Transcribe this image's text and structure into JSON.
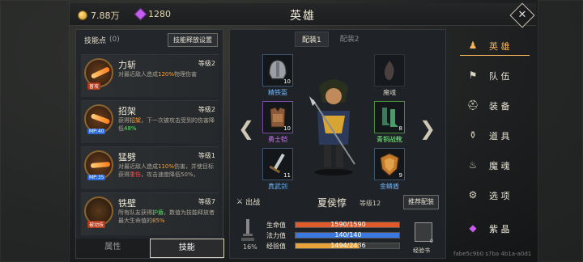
{
  "topbar": {
    "gold": "7.88万",
    "gems": "1280",
    "title": "英雄",
    "close": "✕"
  },
  "skills_panel": {
    "header": "技能点",
    "points": "(0)",
    "release_btn": "技能释放设置",
    "skills": [
      {
        "name": "力斩",
        "level": "等级2",
        "tag": "普攻",
        "tag_color": "#b13a1c",
        "desc_a": "对最近敌人造成",
        "desc_hl": "120%",
        "desc_b": "物理伤害"
      },
      {
        "name": "招架",
        "level": "等级2",
        "tag": "MP:40",
        "tag_color": "#2c6bd8",
        "desc_a": "获得",
        "desc_hl": "招架",
        "desc_b": "，下一次被攻击受到的伤害降低",
        "desc_hl2": "48%"
      },
      {
        "name": "猛劈",
        "level": "等级1",
        "tag": "MP:35",
        "tag_color": "#2c6bd8",
        "desc_a": "对最近敌人造成",
        "desc_hl": "110%",
        "desc_b": "伤害，并使目标获得",
        "desc_hl2": "重伤",
        "desc_c": "，攻击速度降低50%，"
      },
      {
        "name": "铁壁",
        "level": "等级7",
        "tag": "被动技",
        "tag_color": "#b13a1c",
        "desc_a": "所有队友获得",
        "desc_hl": "护盾",
        "desc_b": "，数值为技能释放者最大生命值的",
        "desc_hl2": "85%"
      }
    ],
    "tabs": [
      "属性",
      "技能"
    ]
  },
  "gear": {
    "tabs": [
      "配装1",
      "配装2"
    ],
    "slots": [
      {
        "name": "精铁盔",
        "level": "10",
        "color": "blue"
      },
      {
        "name": "勇士铠",
        "level": "10",
        "color": "purple"
      },
      {
        "name": "真武剑",
        "level": "11",
        "color": "blue"
      },
      {
        "name": "魔魂",
        "level": "",
        "color": "grey"
      },
      {
        "name": "青铜战靴",
        "level": "8",
        "color": "green"
      },
      {
        "name": "金鳞盾",
        "level": "9",
        "color": "blue"
      }
    ],
    "arrows": {
      "left": "❮",
      "right": "❯"
    }
  },
  "hero": {
    "deploy": "出战",
    "name": "夏侯惇",
    "level": "等级12",
    "recommend_btn": "推荐配装",
    "stats": [
      {
        "label": "生命值",
        "text": "1590/1590",
        "fraction": 1.0,
        "color": "#e05a2a"
      },
      {
        "label": "法力值",
        "text": "140/140",
        "fraction": 1.0,
        "color": "#3a78e0"
      },
      {
        "label": "经验值",
        "text": "1494/2436",
        "fraction": 0.613,
        "color": "#e8a23a"
      }
    ],
    "percent": "16%",
    "exp_book": {
      "count": "0",
      "label": "经验书"
    }
  },
  "menu": {
    "items": [
      {
        "label": "英 雄",
        "icon": "person-icon",
        "glyph": "☰",
        "active": true
      },
      {
        "label": "队 伍",
        "icon": "flag-icon",
        "glyph": "⚑",
        "active": false
      },
      {
        "label": "装 备",
        "icon": "helmet-icon",
        "glyph": "⛑",
        "active": false
      },
      {
        "label": "道 具",
        "icon": "bag-icon",
        "glyph": "👜",
        "active": false
      },
      {
        "label": "魔 魂",
        "icon": "flame-icon",
        "glyph": "🔥",
        "active": false
      },
      {
        "label": "选 项",
        "icon": "gear-icon",
        "glyph": "⚙",
        "active": false
      },
      {
        "label": "紫 晶",
        "icon": "crystal-icon",
        "glyph": "◆",
        "active": false
      }
    ]
  },
  "watermark": "fabe5c9b0 s7ba 4b1a-a0d1"
}
